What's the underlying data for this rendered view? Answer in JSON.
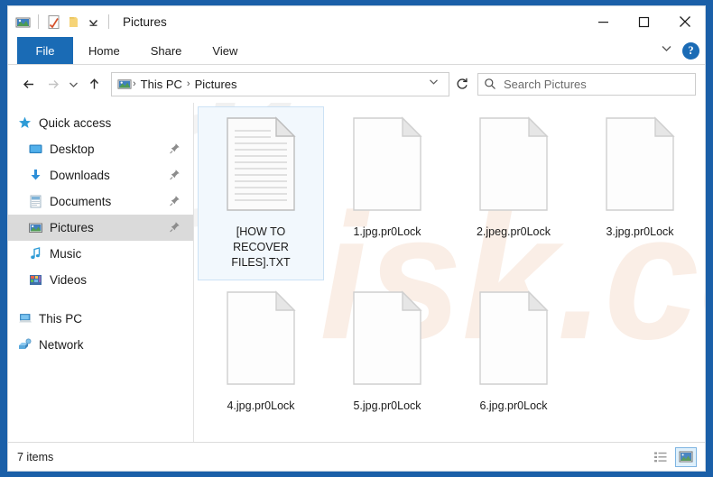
{
  "window": {
    "title": "Pictures",
    "quick_access_icons": [
      "picture-icon",
      "properties-checkmark-icon",
      "new-folder-icon",
      "customize-chevron-icon"
    ],
    "controls": {
      "minimize": "minimize-button",
      "maximize": "maximize-button",
      "close": "close-button"
    }
  },
  "ribbon": {
    "file_tab": "File",
    "tabs": [
      "Home",
      "Share",
      "View"
    ],
    "expand_icon": "chevron-down-icon",
    "help_label": "?"
  },
  "navigation": {
    "back": "back-arrow-icon",
    "forward": "forward-arrow-icon",
    "recent": "recent-locations-chevron-icon",
    "up": "up-arrow-icon",
    "breadcrumb": {
      "icon": "pictures-library-icon",
      "items": [
        "This PC",
        "Pictures"
      ],
      "separator": "›",
      "dropdown_icon": "chevron-down-icon"
    },
    "refresh": "refresh-icon"
  },
  "search": {
    "icon": "search-icon",
    "placeholder": "Search Pictures",
    "value": ""
  },
  "sidebar": {
    "quick_access": {
      "label": "Quick access",
      "icon": "star-icon"
    },
    "items": [
      {
        "label": "Desktop",
        "icon": "desktop-icon",
        "pinned": true,
        "selected": false
      },
      {
        "label": "Downloads",
        "icon": "downloads-icon",
        "pinned": true,
        "selected": false
      },
      {
        "label": "Documents",
        "icon": "documents-icon",
        "pinned": true,
        "selected": false
      },
      {
        "label": "Pictures",
        "icon": "pictures-icon",
        "pinned": true,
        "selected": true
      },
      {
        "label": "Music",
        "icon": "music-icon",
        "pinned": false,
        "selected": false
      },
      {
        "label": "Videos",
        "icon": "videos-icon",
        "pinned": false,
        "selected": false
      }
    ],
    "roots": [
      {
        "label": "This PC",
        "icon": "this-pc-icon"
      },
      {
        "label": "Network",
        "icon": "network-icon"
      }
    ]
  },
  "files": [
    {
      "name": "[HOW TO RECOVER FILES].TXT",
      "icon": "text-file-icon",
      "selected": true
    },
    {
      "name": "1.jpg.pr0Lock",
      "icon": "blank-file-icon",
      "selected": false
    },
    {
      "name": "2.jpeg.pr0Lock",
      "icon": "blank-file-icon",
      "selected": false
    },
    {
      "name": "3.jpg.pr0Lock",
      "icon": "blank-file-icon",
      "selected": false
    },
    {
      "name": "4.jpg.pr0Lock",
      "icon": "blank-file-icon",
      "selected": false
    },
    {
      "name": "5.jpg.pr0Lock",
      "icon": "blank-file-icon",
      "selected": false
    },
    {
      "name": "6.jpg.pr0Lock",
      "icon": "blank-file-icon",
      "selected": false
    }
  ],
  "status": {
    "item_count": "7 items",
    "view_details_icon": "details-view-icon",
    "view_icons_icon": "large-icons-view-icon",
    "active_view": "large-icons-view-icon"
  },
  "watermark": {
    "text": "risk.com",
    "color": "#f7ece4"
  },
  "colors": {
    "accent": "#1a6bb5",
    "window_frame": "#1a5fa8",
    "selection": "#f2f8fd",
    "selection_border": "#cce2f5",
    "nav_selected": "#dadada"
  }
}
